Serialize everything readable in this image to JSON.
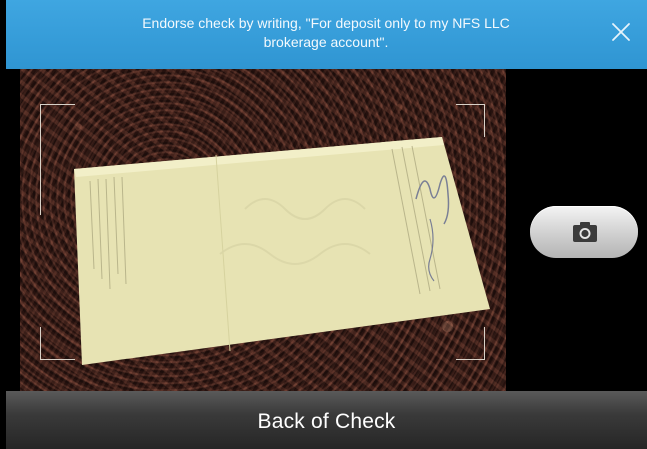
{
  "banner": {
    "text": "Endorse check by writing, \"For deposit only to my NFS LLC brokerage account\".",
    "close_icon": "close-icon"
  },
  "viewfinder": {
    "content": "back-of-check-photo"
  },
  "shutter": {
    "icon": "camera-icon"
  },
  "bottom_bar": {
    "title": "Back of Check"
  },
  "colors": {
    "banner": "#3fa6e1",
    "background": "#000000",
    "bar": "#3a3a3a"
  }
}
